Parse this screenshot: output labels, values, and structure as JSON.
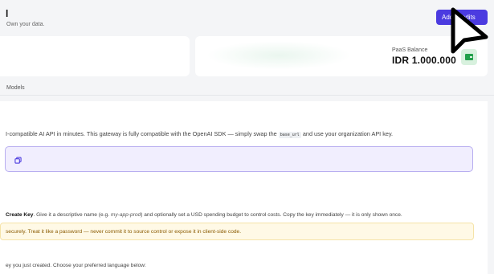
{
  "header": {
    "title": "l",
    "subtitle": "Own your data."
  },
  "toolbar": {
    "topup_label": "Add Credits"
  },
  "balance_card": {
    "label": "PaaS Balance",
    "value": "IDR 1.000.000",
    "icon": "wallet-icon",
    "icon_color": "#22a04a"
  },
  "tabs": {
    "active_label": "Models"
  },
  "main": {
    "intro_before": "I-compatible AI API in minutes. This gateway is fully compatible with the OpenAI SDK — simply swap the ",
    "intro_code": "base_url",
    "intro_after": " and use your organization API key.",
    "copy_icon": "copy-icon",
    "accent_color": "#4b3be0"
  },
  "step": {
    "title": "Create Key",
    "text_before": ". Give it a descriptive name (e.g. ",
    "example": "my-app-prod",
    "text_after": ") and optionally set a USD spending budget to control costs. Copy the key immediately — it is only shown once."
  },
  "warning": {
    "text": "securely. Treat it like a password — never commit it to source control or expose it in client-side code."
  },
  "step2": {
    "text": "ey you just created. Choose your preferred language below:"
  }
}
